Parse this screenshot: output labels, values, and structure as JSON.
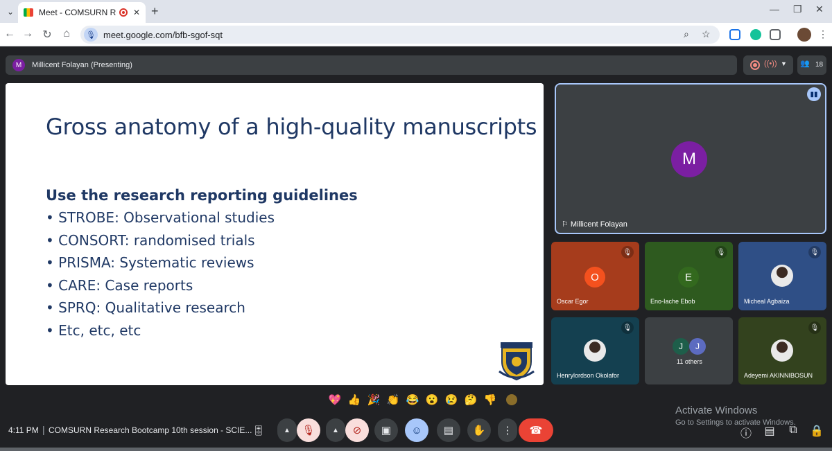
{
  "browser": {
    "tab_title": "Meet - COMSURN Research",
    "url": "meet.google.com/bfb-sgof-sqt"
  },
  "meet": {
    "presenter_initial": "M",
    "presenting_label": "Millicent Folayan (Presenting)",
    "participant_count": "18"
  },
  "slide": {
    "title": "Gross anatomy of a high-quality manuscripts",
    "subheading": "Use the research reporting guidelines",
    "bullets": [
      "STROBE: Observational studies",
      "CONSORT: randomised trials",
      "PRISMA: Systematic reviews",
      "CARE: Case reports",
      "SPRQ: Qualitative research",
      "Etc, etc, etc"
    ]
  },
  "speaker": {
    "initial": "M",
    "name": "Millicent Folayan",
    "avatar_color": "#7b1fa2"
  },
  "tiles": [
    {
      "name": "Oscar Egor",
      "initial": "O",
      "bg": "#a63c1c",
      "avatar_color": "#f4511e"
    },
    {
      "name": "Eno-Iache Ebob",
      "initial": "E",
      "bg": "#2e5a1f",
      "avatar_color": "#33691e"
    },
    {
      "name": "Micheal Agbaiza",
      "initial": "",
      "bg": "#2f4f86"
    },
    {
      "name": "Henrylordson Okolafor",
      "initial": "",
      "bg": "#144050"
    },
    {
      "name": "11 others",
      "initials": [
        "J",
        "J"
      ],
      "bg": "#3c4043",
      "avatar_colors": [
        "#1e5e4a",
        "#5c6bc0"
      ]
    },
    {
      "name": "Adeyemi AKINNIBOSUN",
      "initial": "",
      "bg": "#33421e"
    }
  ],
  "reactions": [
    "💖",
    "👍",
    "🎉",
    "👏",
    "😂",
    "😮",
    "😢",
    "🤔",
    "👎"
  ],
  "watermark": {
    "title": "Activate Windows",
    "subtitle": "Go to Settings to activate Windows."
  },
  "bottom_bar": {
    "time": "4:11 PM",
    "separator": "|",
    "meeting_title": "COMSURN Research Bootcamp 10th session - SCIE..."
  },
  "icons": {
    "mic_off": "mic-off-icon",
    "camera_off": "camera-off-icon",
    "present": "present-screen-icon",
    "emoji": "emoji-icon",
    "captions": "captions-icon",
    "raise_hand": "raise-hand-icon",
    "more": "more-options-icon",
    "end_call": "end-call-icon"
  },
  "colors": {
    "meet_background": "#202124",
    "slide_text": "#1f3864",
    "speaking_outline": "#a8c7fa",
    "end_call": "#ea4335"
  }
}
